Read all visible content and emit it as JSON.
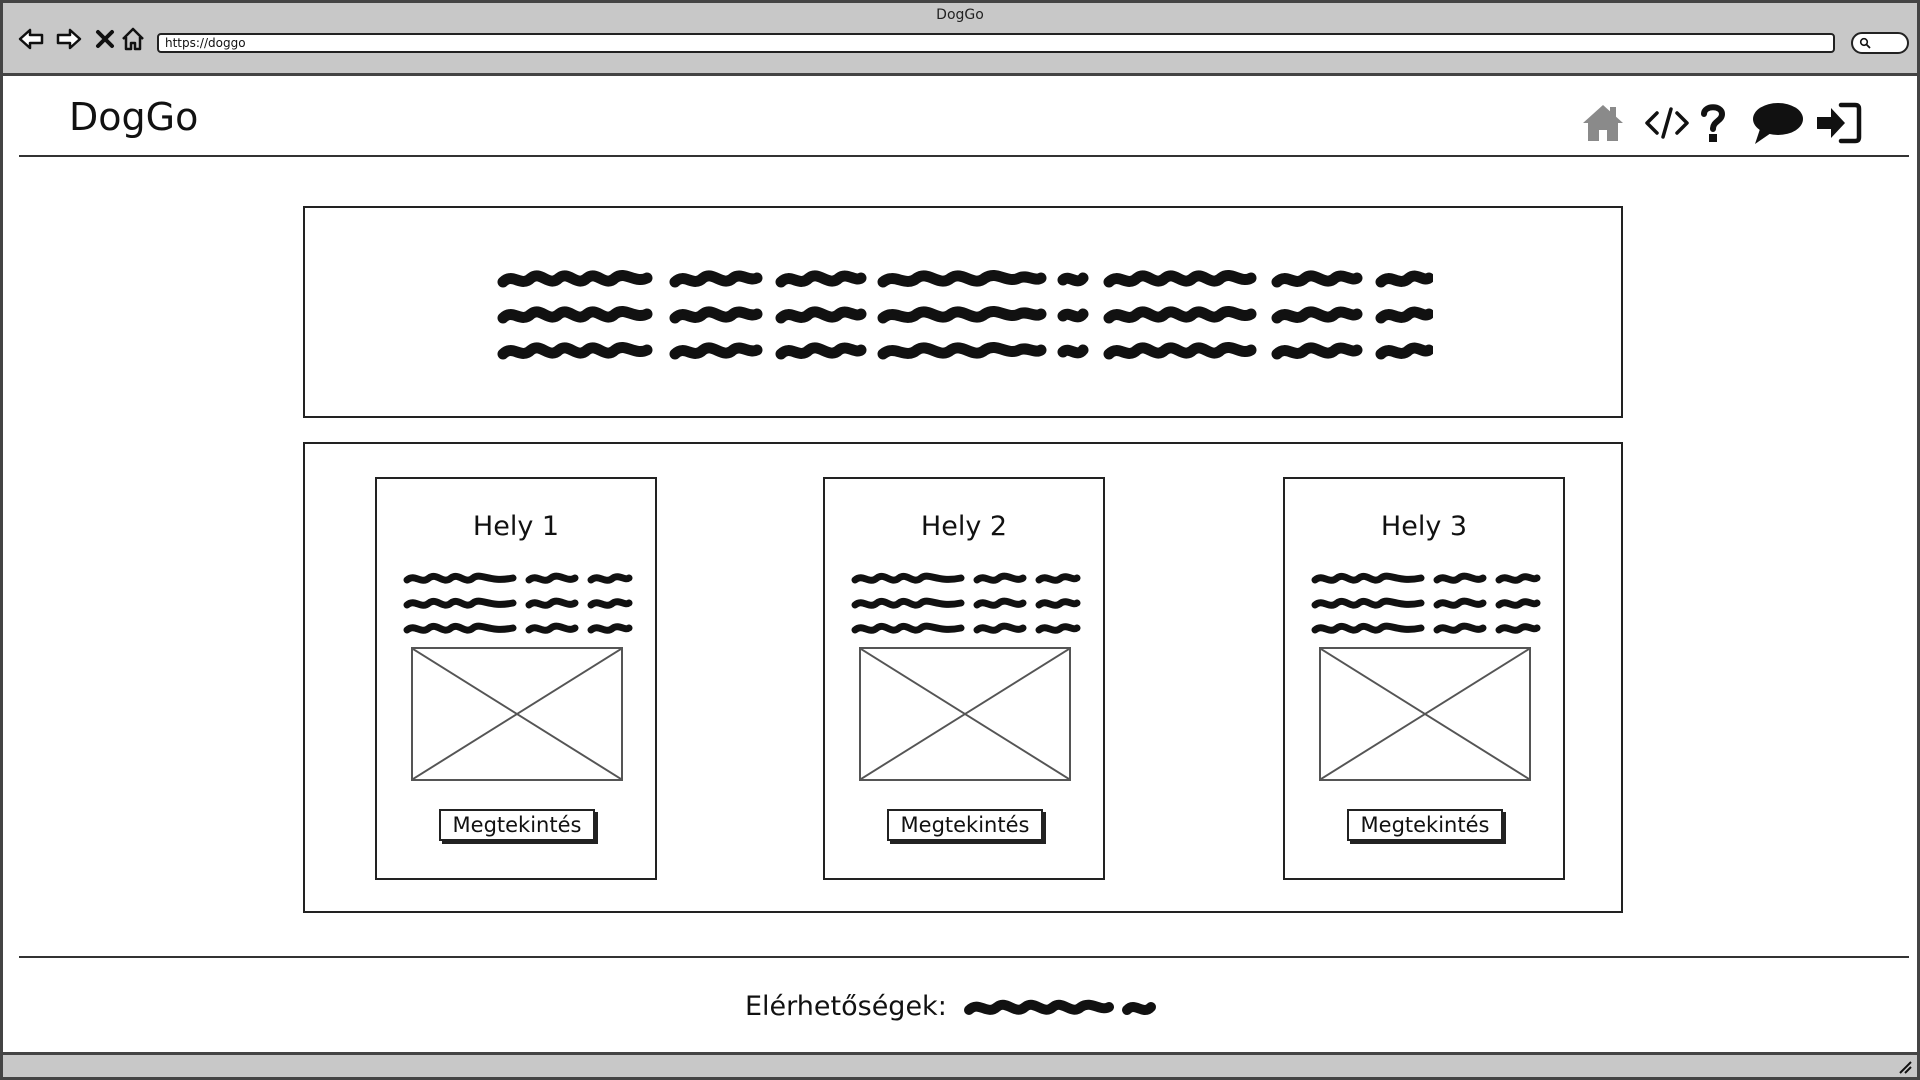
{
  "browser": {
    "window_title": "DogGo",
    "url": "https://doggo"
  },
  "header": {
    "logo": "DogGo",
    "icons": [
      "home-icon",
      "code-icon",
      "help-icon",
      "chat-icon",
      "sign-in-icon"
    ]
  },
  "cards": [
    {
      "title": "Hely 1",
      "button_label": "Megtekintés"
    },
    {
      "title": "Hely 2",
      "button_label": "Megtekintés"
    },
    {
      "title": "Hely 3",
      "button_label": "Megtekintés"
    }
  ],
  "footer": {
    "label": "Elérhetőségek:"
  },
  "colors": {
    "chrome": "#c8c8c8",
    "border": "#222222",
    "home_icon": "#888888"
  }
}
